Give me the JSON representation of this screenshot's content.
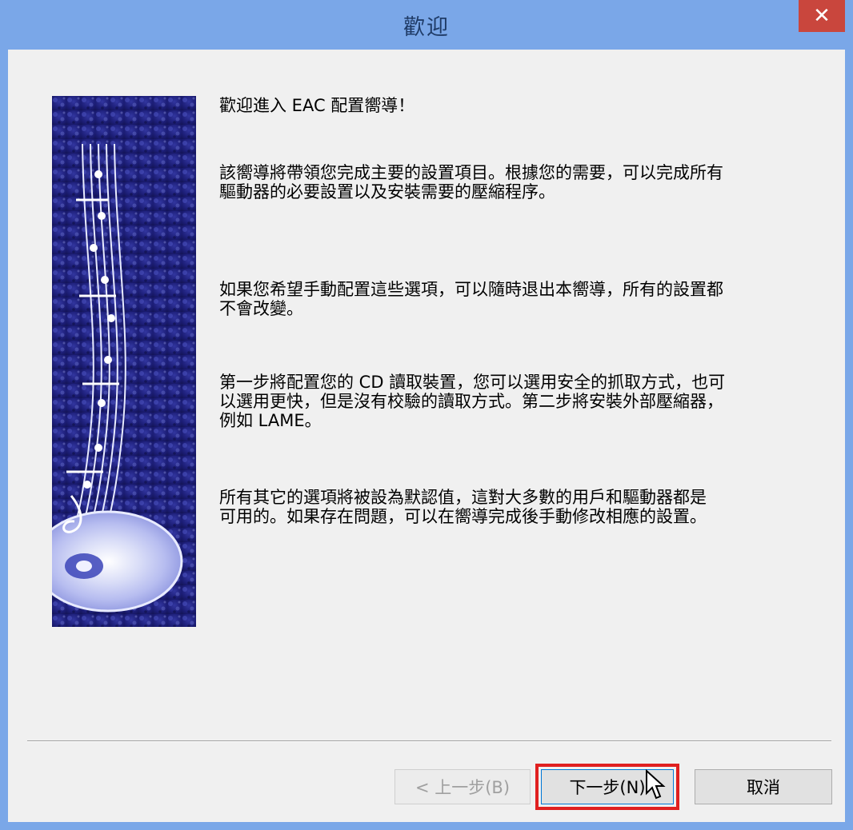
{
  "window": {
    "title": "歡迎",
    "close_label": "✕"
  },
  "content": {
    "paragraphs": [
      "歡迎進入 EAC 配置嚮導！",
      "該嚮導將帶領您完成主要的設置項目。根據您的需要，可以完成所有\n驅動器的必要設置以及安裝需要的壓縮程序。",
      "如果您希望手動配置這些選項，可以隨時退出本嚮導，所有的設置都\n不會改變。",
      "第一步將配置您的 CD 讀取裝置，您可以選用安全的抓取方式，也可\n以選用更快，但是沒有校驗的讀取方式。第二步將安裝外部壓縮器，\n例如 LAME。",
      "所有其它的選項將被設為默認值，這對大多數的用戶和驅動器都是\n可用的。如果存在問題，可以在嚮導完成後手動修改相應的設置。"
    ]
  },
  "buttons": {
    "back_label": "< 上一步(B)",
    "next_label": "下一步(N)",
    "cancel_label": "取消"
  },
  "colors": {
    "title_bar": "#7aa7e8",
    "close_button": "#c9463d",
    "highlight": "#e02020"
  },
  "icons": {
    "close": "close-icon",
    "cursor": "mouse-pointer-icon",
    "sidebar": "music-cd-banner-image"
  }
}
